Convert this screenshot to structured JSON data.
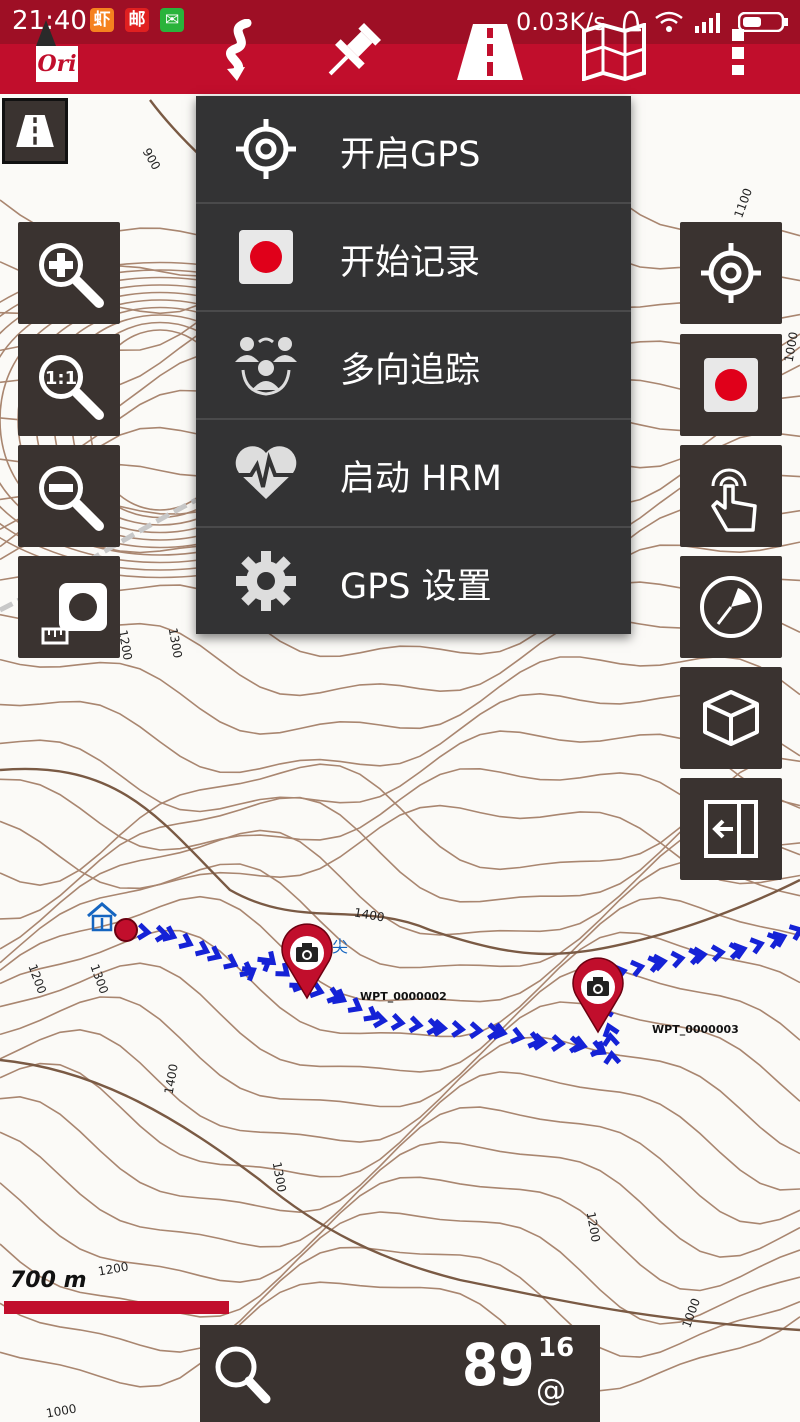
{
  "status_bar": {
    "time": "21:40",
    "net_speed": "0.03K/s",
    "notif_icons": [
      "shrimp-app-icon",
      "mail-app-icon",
      "wechat-icon"
    ],
    "notif_glyphs": [
      "虾",
      "邮",
      "✉"
    ],
    "system_icons": [
      "alarm-icon",
      "wifi-icon",
      "signal-icon",
      "battery-icon"
    ]
  },
  "toolbar": {
    "app_logo": "Ori",
    "buttons": [
      "track-route-icon",
      "pin-icon",
      "road-icon",
      "map-icon",
      "overflow-menu-icon"
    ]
  },
  "left_controls": [
    "zoom-in",
    "zoom-1-1",
    "zoom-out",
    "scale-ruler"
  ],
  "right_controls": [
    "gps-locate",
    "record",
    "touch-gesture",
    "compass-dial",
    "3d-view",
    "exit-panel"
  ],
  "menu": {
    "items": [
      {
        "label": "开启GPS",
        "icon": "gps-crosshair-icon"
      },
      {
        "label": "开始记录",
        "icon": "record-icon"
      },
      {
        "label": "多向追踪",
        "icon": "multi-tracking-icon"
      },
      {
        "label": "启动 HRM",
        "icon": "heart-rate-icon"
      },
      {
        "label": "GPS 设置",
        "icon": "gear-icon"
      }
    ]
  },
  "map": {
    "waypoints": [
      {
        "label": "WPT_0000002",
        "icon": "camera-pin-icon"
      },
      {
        "label": "WPT_0000003",
        "icon": "camera-pin-icon"
      }
    ],
    "contour_labels": [
      "900",
      "1100",
      "1000",
      "1300",
      "1200",
      "1400",
      "1300",
      "1200",
      "1400",
      "1300",
      "1200",
      "1200",
      "1000",
      "1000"
    ],
    "feature_text": "尖",
    "colors": {
      "track": "#1522d6",
      "contour": "#a98670",
      "accent": "#c10e2c"
    }
  },
  "scale": {
    "label": "700 m"
  },
  "bottom_panel": {
    "value": "89",
    "sup": "16",
    "unit": "@"
  }
}
